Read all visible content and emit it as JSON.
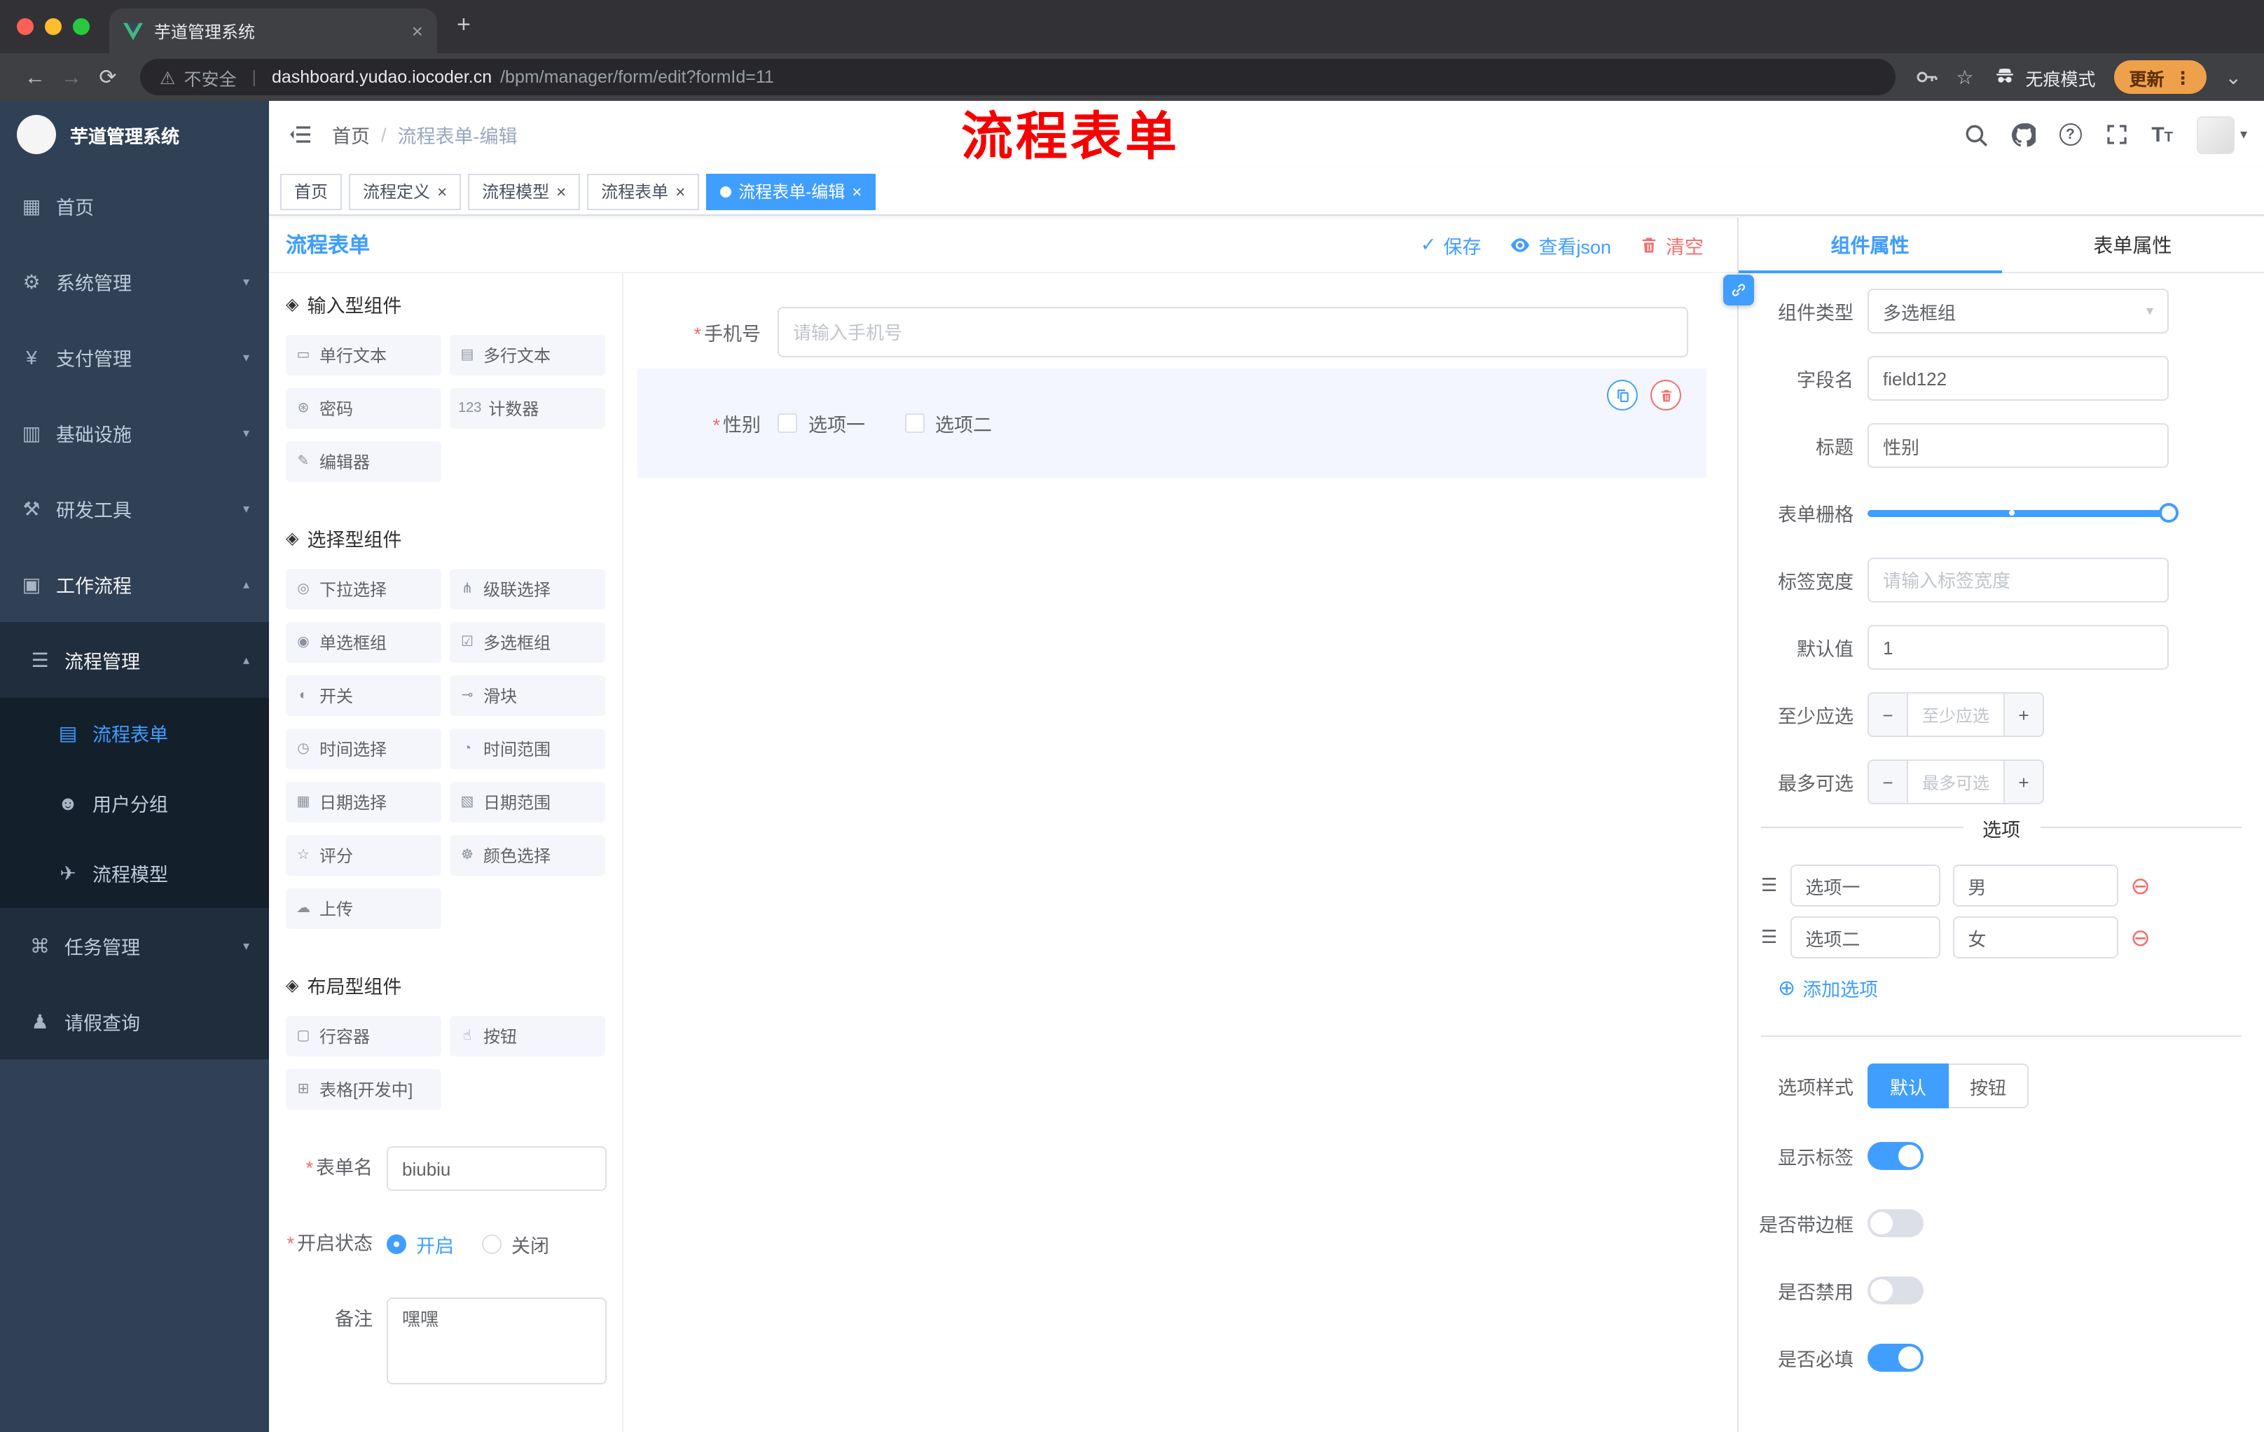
{
  "ui": {
    "asterisk": "*",
    "close": "×",
    "plus": "+",
    "slash": "/",
    "caret_down": "⌄",
    "arrow_down": "▾",
    "arrow_up": "▴",
    "check": "✓",
    "minus": "−",
    "back": "←",
    "forward": "→",
    "reload": "⟳",
    "star": "☆",
    "dots_vertical": "⋮",
    "warning": "⚠",
    "question": "?",
    "t_big": "T",
    "t_small": "T",
    "add_circle": "⊕",
    "remove_circle": "⊖",
    "drag": "☰",
    "section_icon": "◈"
  },
  "browser": {
    "tab_title": "芋道管理系统",
    "security_label": "不安全",
    "url_domain": "dashboard.yudao.iocoder.cn",
    "url_path": "/bpm/manager/form/edit?formId=11",
    "incognito_label": "无痕模式",
    "update_label": "更新"
  },
  "sidebar": {
    "title": "芋道管理系统",
    "items": [
      {
        "label": "首页",
        "icon": "▦"
      },
      {
        "label": "系统管理",
        "icon": "⚙"
      },
      {
        "label": "支付管理",
        "icon": "¥"
      },
      {
        "label": "基础设施",
        "icon": "▥"
      },
      {
        "label": "研发工具",
        "icon": "⚒"
      },
      {
        "label": "工作流程",
        "icon": "▣"
      }
    ],
    "process_mgmt": {
      "label": "流程管理",
      "icon": "☰"
    },
    "process_children": [
      {
        "label": "流程表单",
        "icon": "▤"
      },
      {
        "label": "用户分组",
        "icon": "☻"
      },
      {
        "label": "流程模型",
        "icon": "✈"
      }
    ],
    "task_mgmt": {
      "label": "任务管理",
      "icon": "⌘"
    },
    "leave_query": {
      "label": "请假查询",
      "icon": "♟"
    }
  },
  "header": {
    "breadcrumb_home": "首页",
    "breadcrumb_current": "流程表单-编辑"
  },
  "annotation": "流程表单",
  "tags": [
    {
      "label": "首页"
    },
    {
      "label": "流程定义"
    },
    {
      "label": "流程模型"
    },
    {
      "label": "流程表单"
    },
    {
      "label": "流程表单-编辑"
    }
  ],
  "designer": {
    "title": "流程表单",
    "actions": {
      "save": "保存",
      "view_json": "查看json",
      "clear": "清空"
    },
    "palette": {
      "sections": [
        {
          "title": "输入型组件",
          "items": [
            {
              "label": "单行文本",
              "icon": "▭"
            },
            {
              "label": "多行文本",
              "icon": "▤"
            },
            {
              "label": "密码",
              "icon": "⊛"
            },
            {
              "label": "计数器",
              "icon": "123"
            },
            {
              "label": "编辑器",
              "icon": "✎"
            }
          ]
        },
        {
          "title": "选择型组件",
          "items": [
            {
              "label": "下拉选择",
              "icon": "◎"
            },
            {
              "label": "级联选择",
              "icon": "⋔"
            },
            {
              "label": "单选框组",
              "icon": "◉"
            },
            {
              "label": "多选框组",
              "icon": "☑"
            },
            {
              "label": "开关",
              "icon": "◐"
            },
            {
              "label": "滑块",
              "icon": "⊸"
            },
            {
              "label": "时间选择",
              "icon": "◷"
            },
            {
              "label": "时间范围",
              "icon": "◔"
            },
            {
              "label": "日期选择",
              "icon": "▦"
            },
            {
              "label": "日期范围",
              "icon": "▧"
            },
            {
              "label": "评分",
              "icon": "☆"
            },
            {
              "label": "颜色选择",
              "icon": "☸"
            },
            {
              "label": "上传",
              "icon": "☁"
            }
          ]
        },
        {
          "title": "布局型组件",
          "items": [
            {
              "label": "行容器",
              "icon": "▢"
            },
            {
              "label": "按钮",
              "icon": "☝"
            },
            {
              "label": "表格[开发中]",
              "icon": "⊞"
            }
          ]
        }
      ]
    },
    "meta": {
      "name_label": "表单名",
      "name_value": "biubiu",
      "status_label": "开启状态",
      "status_on": "开启",
      "status_off": "关闭",
      "remark_label": "备注",
      "remark_value": "嘿嘿"
    },
    "canvas": {
      "phone_label": "手机号",
      "phone_placeholder": "请输入手机号",
      "gender_label": "性别",
      "gender_options": [
        {
          "label": "选项一"
        },
        {
          "label": "选项二"
        }
      ]
    }
  },
  "props": {
    "tabs": [
      {
        "label": "组件属性"
      },
      {
        "label": "表单属性"
      }
    ],
    "fields": {
      "type_label": "组件类型",
      "type_value": "多选框组",
      "name_label": "字段名",
      "name_value": "field122",
      "title_label": "标题",
      "title_value": "性别",
      "grid_label": "表单栅格",
      "width_label": "标签宽度",
      "width_placeholder": "请输入标签宽度",
      "default_label": "默认值",
      "default_value": "1",
      "min_label": "至少应选",
      "min_placeholder": "至少应选",
      "max_label": "最多可选",
      "max_placeholder": "最多可选"
    },
    "options": {
      "divider_title": "选项",
      "rows": [
        {
          "name": "选项一",
          "value": "男"
        },
        {
          "name": "选项二",
          "value": "女"
        }
      ],
      "add_label": "添加选项"
    },
    "style": {
      "label": "选项样式",
      "options": [
        {
          "label": "默认"
        },
        {
          "label": "按钮"
        }
      ]
    },
    "switches": [
      {
        "label": "显示标签",
        "on": true
      },
      {
        "label": "是否带边框",
        "on": false
      },
      {
        "label": "是否禁用",
        "on": false
      },
      {
        "label": "是否必填",
        "on": true
      }
    ]
  }
}
